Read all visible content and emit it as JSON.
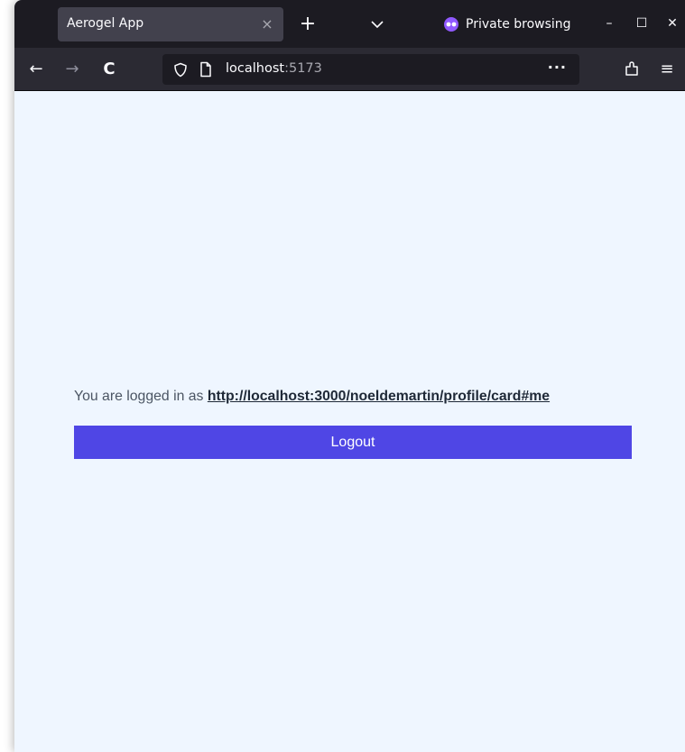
{
  "browser": {
    "tab": {
      "title": "Aerogel App",
      "close_glyph": "×"
    },
    "new_tab_glyph": "+",
    "private_label": "Private browsing",
    "window_controls": {
      "minimize": "–",
      "maximize": "☐",
      "close": "✕"
    },
    "nav": {
      "back": "←",
      "forward": "→",
      "reload": "C",
      "more": "···",
      "menu": "≡"
    },
    "url": {
      "host": "localhost",
      "port": ":5173"
    }
  },
  "page": {
    "login_prefix": "You are logged in as ",
    "webid": "http://localhost:3000/noeldemartin/profile/card#me",
    "logout_label": "Logout"
  },
  "colors": {
    "page_background": "#eff6ff",
    "button_background": "#4f46e5",
    "private_accent": "#9059ff"
  }
}
